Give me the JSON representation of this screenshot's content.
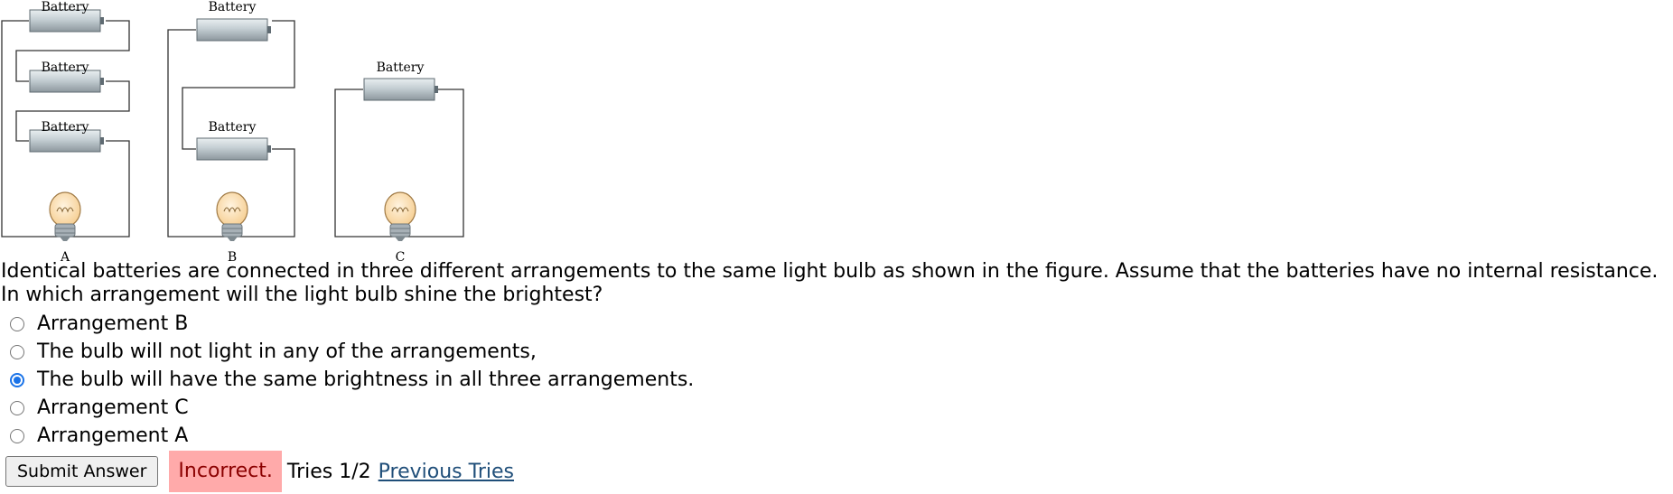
{
  "figure": {
    "battery_label": "Battery",
    "arrangement_labels": [
      "A",
      "B",
      "C"
    ],
    "colors": {
      "wire": "#333333",
      "battery_body": "#c4ced3",
      "bulb_glass": "#fde2b8",
      "bulb_base": "#9aa4ab"
    }
  },
  "question": {
    "text": "Identical batteries are connected in three different arrangements to the same light bulb as shown in the figure. Assume that the batteries have no internal resistance. In which arrangement will the light bulb shine the brightest?"
  },
  "options": [
    {
      "label": "Arrangement B",
      "selected": false
    },
    {
      "label": "The bulb will not light in any of the arrangements,",
      "selected": false
    },
    {
      "label": "The bulb will have the same brightness in all three arrangements.",
      "selected": true
    },
    {
      "label": "Arrangement C",
      "selected": false
    },
    {
      "label": "Arrangement A",
      "selected": false
    }
  ],
  "footer": {
    "submit_label": "Submit Answer",
    "feedback": "Incorrect.",
    "tries": "Tries 1/2",
    "previous_tries_link": "Previous Tries"
  }
}
